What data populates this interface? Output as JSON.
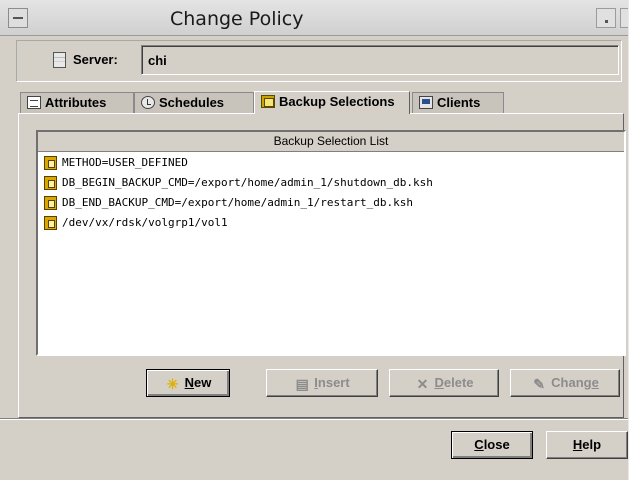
{
  "window": {
    "title": "Change Policy",
    "colors": {
      "background": "#d4d0c8",
      "list_background": "#ffffff",
      "file_icon": "#d8a800"
    }
  },
  "server": {
    "label": "Server:",
    "value": "chi"
  },
  "tabs": [
    {
      "label": "Attributes",
      "icon": "attributes-icon",
      "active": false
    },
    {
      "label": "Schedules",
      "icon": "schedules-icon",
      "active": false
    },
    {
      "label": "Backup Selections",
      "icon": "backup-selections-icon",
      "active": true
    },
    {
      "label": "Clients",
      "icon": "clients-icon",
      "active": false
    }
  ],
  "backup_list": {
    "header": "Backup Selection List",
    "items": [
      "METHOD=USER_DEFINED",
      "DB_BEGIN_BACKUP_CMD=/export/home/admin_1/shutdown_db.ksh",
      "DB_END_BACKUP_CMD=/export/home/admin_1/restart_db.ksh",
      "/dev/vx/rdsk/volgrp1/vol1"
    ]
  },
  "actions": {
    "new": {
      "label_pre": "",
      "mnemonic": "N",
      "label_post": "ew",
      "enabled": true
    },
    "insert": {
      "label_pre": "",
      "mnemonic": "I",
      "label_post": "nsert",
      "enabled": false
    },
    "delete": {
      "label_pre": "",
      "mnemonic": "D",
      "label_post": "elete",
      "enabled": false
    },
    "change": {
      "label_pre": "Chang",
      "mnemonic": "e",
      "label_post": "",
      "enabled": false
    }
  },
  "footer": {
    "close": {
      "label_pre": "",
      "mnemonic": "C",
      "label_post": "lose"
    },
    "help": {
      "label_pre": "",
      "mnemonic": "H",
      "label_post": "elp"
    }
  }
}
